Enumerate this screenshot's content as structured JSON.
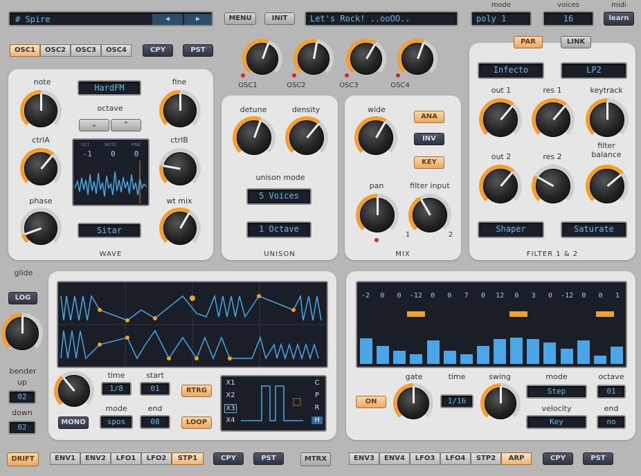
{
  "top": {
    "preset_name": "# Spire",
    "prev_icon": "◀",
    "next_icon": "▶",
    "menu": "MENU",
    "init": "INIT",
    "patch_name": "Let's Rock! ..ooOO..",
    "mode_label": "mode",
    "mode_value": "poly 1",
    "voices_label": "voices",
    "voices_value": "16",
    "midi_label": "midi",
    "midi_button": "learn"
  },
  "osc_tabs": [
    "OSC1",
    "OSC2",
    "OSC3",
    "OSC4"
  ],
  "osc_copy": "CPY",
  "osc_paste": "PST",
  "osc_levels": [
    "OSC1",
    "OSC2",
    "OSC3",
    "OSC4"
  ],
  "wave": {
    "note": "note",
    "fine": "fine",
    "type": "HardFM",
    "octave": "octave",
    "oct_down": "⌄",
    "oct_up": "⌃",
    "ctrlA": "ctrlA",
    "ctrlB": "ctrlB",
    "phase": "phase",
    "wt_mix": "wt mix",
    "display_labels": [
      "OCT",
      "NOTE",
      "FINE"
    ],
    "display_values": [
      "-1",
      "0",
      "0"
    ],
    "wt_select": "Sitar",
    "section": "WAVE"
  },
  "unison": {
    "detune": "detune",
    "density": "density",
    "mode_label": "unison mode",
    "voices": "5 Voices",
    "octave": "1 Octave",
    "section": "UNISON"
  },
  "mix": {
    "wide": "wide",
    "ana": "ANA",
    "inv": "INV",
    "key": "KEY",
    "pan": "pan",
    "filter_input": "filter input",
    "fi_1": "1",
    "fi_2": "2",
    "section": "MIX"
  },
  "filter": {
    "par": "PAR",
    "link": "LINK",
    "type1": "Infecto",
    "type2": "LP2",
    "out1": "out 1",
    "res1": "res 1",
    "keytrack": "keytrack",
    "out2": "out 2",
    "res2": "res 2",
    "balance": "filter\nbalance",
    "shaper": "Shaper",
    "saturate": "Saturate",
    "section": "FILTER 1 & 2"
  },
  "glide": {
    "glide": "glide",
    "log": "LOG",
    "bender": "bender",
    "up": "up",
    "up_val": "02",
    "down": "down",
    "down_val": "02"
  },
  "step": {
    "time": "time",
    "time_val": "1/8",
    "start": "start",
    "start_val": "01",
    "rtrg": "RTRG",
    "mono": "MONO",
    "mode": "mode",
    "mode_val": "spos",
    "end": "end",
    "end_val": "08",
    "loop": "LOOP",
    "x_labels": [
      "X1",
      "X2",
      "X3",
      "X4"
    ],
    "c_labels": [
      "C",
      "P",
      "R",
      "H"
    ]
  },
  "arp": {
    "values": [
      "-2",
      "0",
      "0",
      "-12",
      "0",
      "0",
      "7",
      "0",
      "12",
      "0",
      "3",
      "0",
      "-12",
      "0",
      "0",
      "1"
    ],
    "on": "ON",
    "gate": "gate",
    "time": "time",
    "time_val": "1/16",
    "swing": "swing",
    "mode": "mode",
    "mode_val": "Step",
    "velocity": "velocity",
    "velocity_val": "Key",
    "octave": "octave",
    "octave_val": "01",
    "end": "end",
    "end_val": "no",
    "bars": [
      0.6,
      0.42,
      0.3,
      0.22,
      0.55,
      0.3,
      0.22,
      0.42,
      0.58,
      0.62,
      0.58,
      0.5,
      0.36,
      0.55,
      0.2,
      0.4
    ]
  },
  "bottom": {
    "drift": "DRIFT",
    "left_tabs": [
      "ENV1",
      "ENV2",
      "LFO1",
      "LFO2",
      "STP1"
    ],
    "cpy": "CPY",
    "pst": "PST",
    "mtrx": "MTRX",
    "right_tabs": [
      "ENV3",
      "ENV4",
      "LFO3",
      "LFO4",
      "STP2",
      "ARP"
    ],
    "cpy2": "CPY",
    "pst2": "PST"
  },
  "colors": {
    "accent": "#f0a030",
    "lcd_text": "#6fb6e6",
    "panel": "#e6e6e6"
  }
}
